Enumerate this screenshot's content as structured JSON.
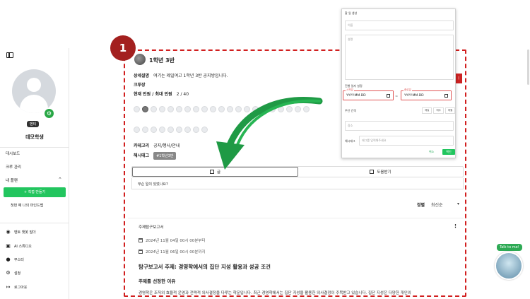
{
  "sidebar": {
    "role_badge": "멘티",
    "username": "데모학생",
    "items": [
      {
        "label": "대시보드"
      },
      {
        "label": "크루 관리"
      },
      {
        "label": "내 플랜"
      }
    ],
    "create_button": "+ 직접 만들기",
    "plan_item": "첫번 째 나의 마인드맵",
    "bottom_items": [
      {
        "label": "멘토 챗봇 빌더",
        "icon": "robot-icon"
      },
      {
        "label": "AI 스튜디오",
        "icon": "ai-icon"
      },
      {
        "label": "부스터",
        "icon": "booster-icon"
      },
      {
        "label": "설정",
        "icon": "gear-icon"
      },
      {
        "label": "로그아웃",
        "icon": "logout-icon"
      }
    ]
  },
  "step_badge": "1",
  "crew": {
    "title": "1학년 3반",
    "detail_label": "상세설명",
    "detail_value": "여기는 제일여고 1학년 3반 공지방입니다.",
    "leader_label": "크루장",
    "members_label": "현재 인원 / 최대 인원",
    "members_value": "2 / 40",
    "member_slots_row1": 21,
    "member_slots_row2": 9,
    "active_member_index": 1,
    "category_label": "카테고리",
    "category_value": "공지/행사/안내",
    "hashtag_label": "해시태그",
    "hashtag_value": "#1학년3반"
  },
  "tabs": [
    {
      "label": "글",
      "active": true
    },
    {
      "label": "도움받기",
      "active": false
    }
  ],
  "post_placeholder": "무슨 일이 있었나요?",
  "sort": {
    "label": "정렬",
    "value": "최신순"
  },
  "post": {
    "category": "주제탐구보고서",
    "date_start": "2024년 11월 04일 00시 00분부터",
    "date_end": "2024년 11월 06일 00시 00분까지",
    "title": "탐구보고서 주제: 경영학에서의 집단 지성 활용과 성공 조건",
    "subtitle": "주제를 선정한 이유",
    "body": "경영학은 조직의 효율적 운영과 전략적 의사결정을 다루는 학문입니다. 최근 경영학에서는 집단 지성을 활용한 의사결정이 주목받고 있습니다. 집단 지성은 다양한 개인의"
  },
  "overlay": {
    "header": "할 일 생성",
    "name_placeholder": "이름",
    "desc_placeholder": "설명",
    "period_label": "진행 일자 설정",
    "start_tag": "시작일",
    "end_tag": "종료일",
    "date_placeholder": "YYYY.MM.DD",
    "dash": "~",
    "repeat_label": "주단 간격",
    "repeat_chips": [
      "매일",
      "매주",
      "매월"
    ],
    "location_placeholder": "장소",
    "hashtag_label": "해시태그",
    "hashtag_placeholder": "태그를 입력해주세요",
    "cancel": "취소",
    "confirm": "확인"
  },
  "chat": {
    "bubble": "Talk to me!"
  },
  "colors": {
    "accent_green": "#22c55e",
    "annotation_red": "#d11f1f",
    "badge_red": "#a3201f",
    "arrow_green": "#1f9a45"
  }
}
